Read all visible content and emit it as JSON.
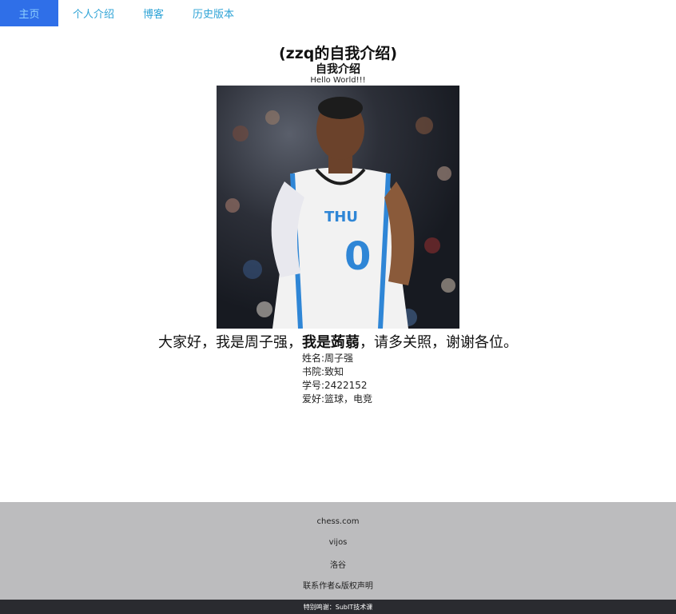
{
  "nav": {
    "items": [
      {
        "label": "主页"
      },
      {
        "label": "个人介绍"
      },
      {
        "label": "博客"
      },
      {
        "label": "历史版本"
      }
    ]
  },
  "main": {
    "title": "(zzq的自我介绍)",
    "subtitle": "自我介绍",
    "hello": "Hello World!!!",
    "greeting_start": "大家好，我是周子强，",
    "greeting_bold": "我是蒟蒻",
    "greeting_end": "，请多关照，谢谢各位。",
    "info": [
      "姓名:周子强",
      "书院:致知",
      "学号:2422152",
      "爱好:篮球，电竞"
    ]
  },
  "footer": {
    "links": [
      "chess.com",
      "vijos",
      "洛谷",
      "联系作者&版权声明"
    ],
    "credit": "特别鸣谢：SubIT技术课"
  },
  "colors": {
    "nav_active_bg": "#2f6fe8",
    "nav_link": "#2ea3d6",
    "footer_bg": "#bcbcbe",
    "bottom_bar_bg": "#2a2b30"
  }
}
